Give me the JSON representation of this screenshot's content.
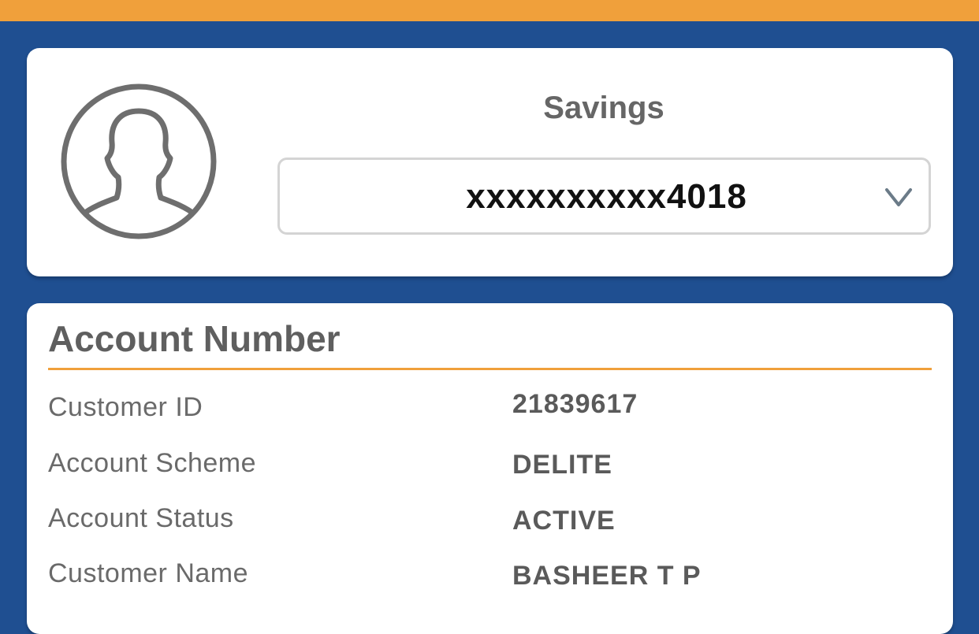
{
  "account_card": {
    "account_type": "Savings",
    "account_selector": {
      "selected_value": "xxxxxxxxxx4018",
      "chevron_icon": "chevron-down-icon"
    },
    "avatar_icon": "user-avatar-icon"
  },
  "details": {
    "title": "Account Number",
    "rows": [
      {
        "label": "Customer ID",
        "value": "21839617"
      },
      {
        "label": "Account Scheme",
        "value": "DELITE"
      },
      {
        "label": "Account Status",
        "value": "ACTIVE"
      },
      {
        "label": "Customer Name",
        "value": "BASHEER T P"
      }
    ]
  },
  "colors": {
    "top_bar": "#f0a03b",
    "background": "#1f4f91",
    "accent_divider": "#f0a03b",
    "card": "#ffffff"
  }
}
